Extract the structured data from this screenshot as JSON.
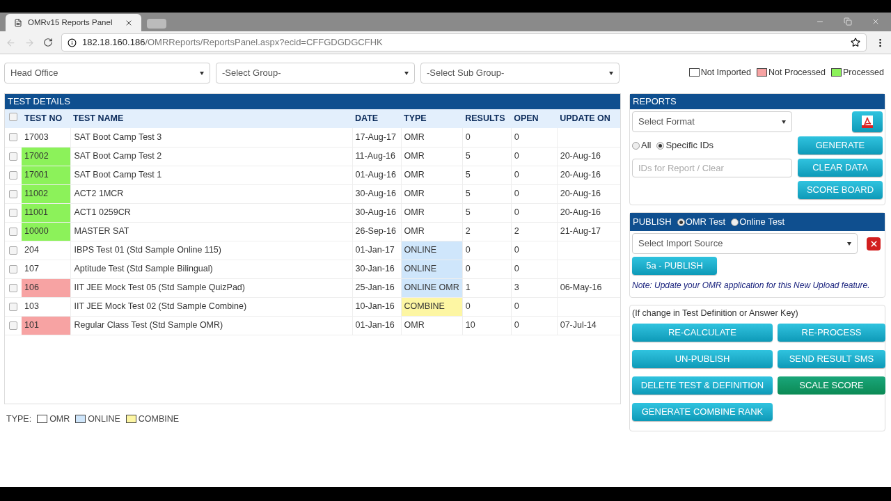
{
  "browser": {
    "tab_title": "OMRv15 Reports Panel",
    "url_host": "182.18.160.186",
    "url_path": "/OMRReports/ReportsPanel.aspx?ecid=CFFGDGDGCFHK"
  },
  "filters": [
    {
      "value": "Head Office"
    },
    {
      "value": "-Select Group-"
    },
    {
      "value": "-Select Sub Group-"
    }
  ],
  "status_legend": [
    {
      "label": "Not Imported",
      "color": "#ffffff"
    },
    {
      "label": "Not Processed",
      "color": "#f7a3a3"
    },
    {
      "label": "Processed",
      "color": "#8cf25a"
    }
  ],
  "test_details": {
    "title": "TEST DETAILS",
    "select_all_checked": false,
    "columns": [
      "TEST NO",
      "TEST NAME",
      "DATE",
      "TYPE",
      "RESULTS",
      "OPEN",
      "UPDATE ON"
    ],
    "rows": [
      {
        "checked": false,
        "test_no": "17003",
        "color": "#ffffff",
        "name": "SAT Boot Camp Test 3",
        "date": "17-Aug-17",
        "type": {
          "label": "OMR",
          "color": "#ffffff"
        },
        "results": "0",
        "open": "0",
        "update_on": ""
      },
      {
        "checked": false,
        "test_no": "17002",
        "color": "#8cf25a",
        "name": "SAT Boot Camp Test 2",
        "date": "11-Aug-16",
        "type": {
          "label": "OMR",
          "color": "#ffffff"
        },
        "results": "5",
        "open": "0",
        "update_on": "20-Aug-16"
      },
      {
        "checked": false,
        "test_no": "17001",
        "color": "#8cf25a",
        "name": "SAT Boot Camp Test 1",
        "date": "01-Aug-16",
        "type": {
          "label": "OMR",
          "color": "#ffffff"
        },
        "results": "5",
        "open": "0",
        "update_on": "20-Aug-16"
      },
      {
        "checked": false,
        "test_no": "11002",
        "color": "#8cf25a",
        "name": "ACT2 1MCR",
        "date": "30-Aug-16",
        "type": {
          "label": "OMR",
          "color": "#ffffff"
        },
        "results": "5",
        "open": "0",
        "update_on": "20-Aug-16"
      },
      {
        "checked": false,
        "test_no": "11001",
        "color": "#8cf25a",
        "name": "ACT1 0259CR",
        "date": "30-Aug-16",
        "type": {
          "label": "OMR",
          "color": "#ffffff"
        },
        "results": "5",
        "open": "0",
        "update_on": "20-Aug-16"
      },
      {
        "checked": false,
        "test_no": "10000",
        "color": "#8cf25a",
        "name": "MASTER SAT",
        "date": "26-Sep-16",
        "type": {
          "label": "OMR",
          "color": "#ffffff"
        },
        "results": "2",
        "open": "2",
        "update_on": "21-Aug-17"
      },
      {
        "checked": false,
        "test_no": "204",
        "color": "#ffffff",
        "name": "IBPS Test 01 (Std Sample Online 115)",
        "date": "01-Jan-17",
        "type": {
          "label": "ONLINE",
          "color": "#cfe6fb"
        },
        "results": "0",
        "open": "0",
        "update_on": ""
      },
      {
        "checked": false,
        "test_no": "107",
        "color": "#ffffff",
        "name": "Aptitude Test (Std Sample Bilingual)",
        "date": "30-Jan-16",
        "type": {
          "label": "ONLINE",
          "color": "#cfe6fb"
        },
        "results": "0",
        "open": "0",
        "update_on": ""
      },
      {
        "checked": false,
        "test_no": "106",
        "color": "#f7a3a3",
        "name": "IIT JEE Mock Test 05 (Std Sample QuizPad)",
        "date": "25-Jan-16",
        "type": {
          "label": "ONLINE OMR",
          "color": "#cfe6fb"
        },
        "results": "1",
        "open": "3",
        "update_on": "06-May-16"
      },
      {
        "checked": false,
        "test_no": "103",
        "color": "#ffffff",
        "name": "IIT JEE Mock Test 02 (Std Sample Combine)",
        "date": "10-Jan-16",
        "type": {
          "label": "COMBINE",
          "color": "#fdf6a3"
        },
        "results": "0",
        "open": "0",
        "update_on": ""
      },
      {
        "checked": false,
        "test_no": "101",
        "color": "#f7a3a3",
        "name": "Regular Class Test (Std Sample OMR)",
        "date": "01-Jan-16",
        "type": {
          "label": "OMR",
          "color": "#ffffff"
        },
        "results": "10",
        "open": "0",
        "update_on": "07-Jul-14"
      }
    ]
  },
  "type_legend": {
    "label": "TYPE:",
    "items": [
      {
        "label": "OMR",
        "color": "#ffffff"
      },
      {
        "label": "ONLINE",
        "color": "#cfe6fb"
      },
      {
        "label": "COMBINE",
        "color": "#fdf6a3"
      }
    ]
  },
  "reports": {
    "title": "REPORTS",
    "format_select": "Select Format",
    "scope": [
      {
        "label": "All",
        "selected": false
      },
      {
        "label": "Specific IDs",
        "selected": true
      }
    ],
    "ids_placeholder": "IDs for Report / Clear",
    "buttons": [
      "GENERATE",
      "CLEAR DATA",
      "SCORE BOARD"
    ]
  },
  "publish": {
    "title": "PUBLISH",
    "modes": [
      {
        "label": "OMR Test",
        "selected": true
      },
      {
        "label": "Online Test",
        "selected": false
      }
    ],
    "source_select": "Select Import Source",
    "button": "5a - PUBLISH",
    "note": "Note: Update your OMR application for this New Upload feature."
  },
  "maintenance": {
    "hint": "(If change in Test Definition or Answer Key)",
    "buttons": [
      {
        "label": "RE-CALCULATE",
        "hovered": false
      },
      {
        "label": "RE-PROCESS",
        "hovered": false
      },
      {
        "label": "UN-PUBLISH",
        "hovered": false
      },
      {
        "label": "SEND RESULT SMS",
        "hovered": false
      },
      {
        "label": "DELETE TEST & DEFINITION",
        "hovered": false
      },
      {
        "label": "SCALE SCORE",
        "hovered": true
      },
      {
        "label": "GENERATE COMBINE RANK",
        "hovered": false
      }
    ]
  }
}
